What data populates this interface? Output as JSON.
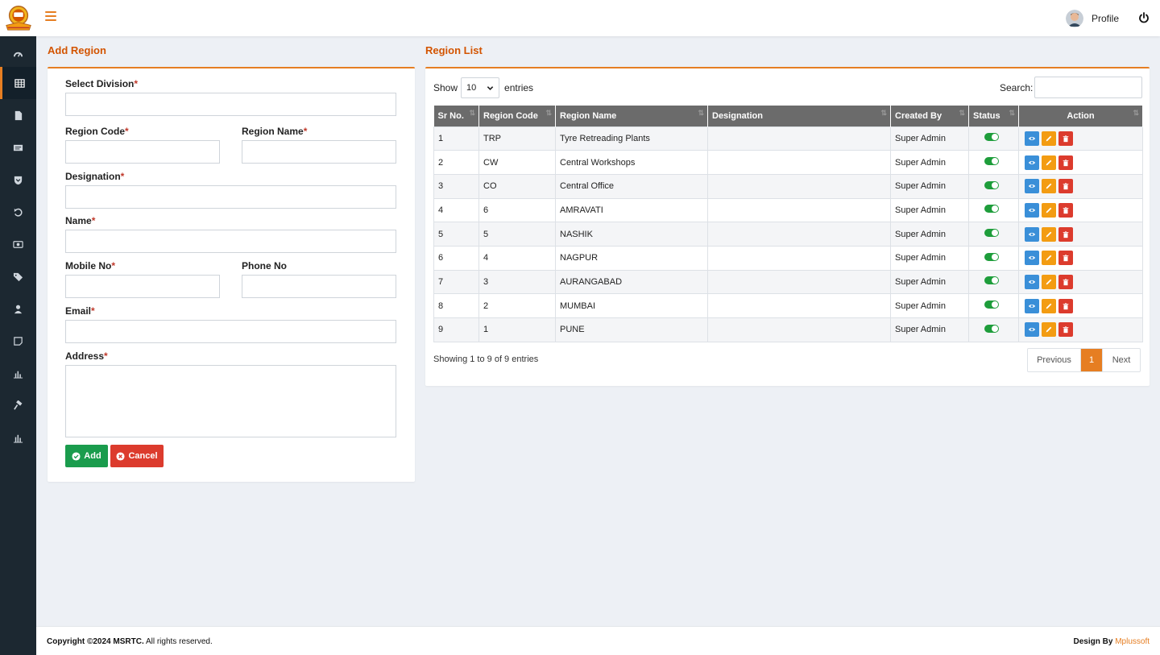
{
  "header": {
    "profile_label": "Profile"
  },
  "sidebar": {
    "icons": [
      "dashboard-icon",
      "grid-icon",
      "file-icon",
      "list-card-icon",
      "shield-icon",
      "undo-icon",
      "money-icon",
      "tag-icon",
      "user-icon",
      "note-icon",
      "bar-chart-icon",
      "hammer-icon",
      "bar-chart-icon"
    ]
  },
  "form": {
    "title": "Add Region",
    "division_label": "Select Division",
    "region_code_label": "Region Code",
    "region_name_label": "Region Name",
    "designation_label": "Designation",
    "name_label": "Name",
    "mobile_label": "Mobile No",
    "phone_label": "Phone No",
    "email_label": "Email",
    "address_label": "Address",
    "required_mark": "*",
    "add_label": "Add",
    "cancel_label": "Cancel"
  },
  "list": {
    "title": "Region List",
    "show_label": "Show",
    "entries_value": "10",
    "entries_label": "entries",
    "search_label": "Search:",
    "columns": [
      "Sr No.",
      "Region Code",
      "Region Name",
      "Designation",
      "Created By",
      "Status",
      "Action"
    ],
    "rows": [
      {
        "sr": "1",
        "code": "TRP",
        "name": "Tyre Retreading Plants",
        "designation": "",
        "created_by": "Super Admin"
      },
      {
        "sr": "2",
        "code": "CW",
        "name": "Central Workshops",
        "designation": "",
        "created_by": "Super Admin"
      },
      {
        "sr": "3",
        "code": "CO",
        "name": "Central Office",
        "designation": "",
        "created_by": "Super Admin"
      },
      {
        "sr": "4",
        "code": "6",
        "name": "AMRAVATI",
        "designation": "",
        "created_by": "Super Admin"
      },
      {
        "sr": "5",
        "code": "5",
        "name": "NASHIK",
        "designation": "",
        "created_by": "Super Admin"
      },
      {
        "sr": "6",
        "code": "4",
        "name": "NAGPUR",
        "designation": "",
        "created_by": "Super Admin"
      },
      {
        "sr": "7",
        "code": "3",
        "name": "AURANGABAD",
        "designation": "",
        "created_by": "Super Admin"
      },
      {
        "sr": "8",
        "code": "2",
        "name": "MUMBAI",
        "designation": "",
        "created_by": "Super Admin"
      },
      {
        "sr": "9",
        "code": "1",
        "name": "PUNE",
        "designation": "",
        "created_by": "Super Admin"
      }
    ],
    "info": "Showing 1 to 9 of 9 entries",
    "prev_label": "Previous",
    "current_page": "1",
    "next_label": "Next"
  },
  "footer": {
    "copyright_bold": "Copyright ©2024 MSRTC.",
    "copyright_rest": " All rights reserved.",
    "design_prefix": "Design By ",
    "design_brand": "Mplussoft"
  },
  "colors": {
    "accent": "#e67e22",
    "sidebar": "#1c2831",
    "success": "#1a9c4d",
    "danger": "#dc3b2d",
    "info": "#3a8fd8",
    "warning": "#f39c12"
  }
}
